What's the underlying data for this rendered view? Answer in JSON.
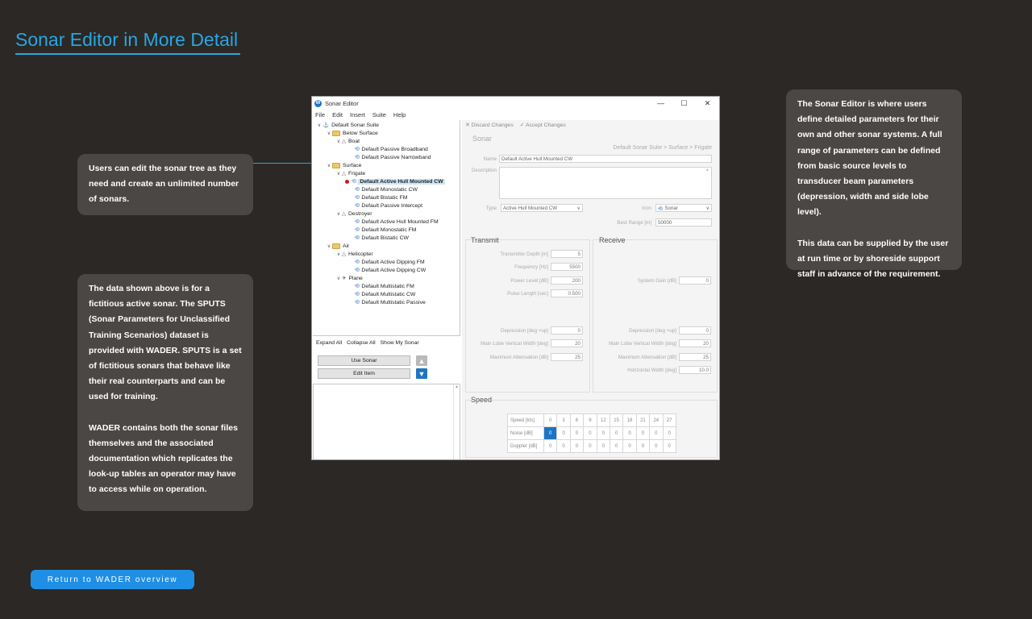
{
  "page": {
    "title": "Sonar Editor in More Detail",
    "return_label": "Return to WADER overview"
  },
  "callouts": {
    "tree": "Users can edit the sonar tree as they need and create an unlimited number of sonars.",
    "data_p1": "The data shown above is for a fictitious active sonar. The SPUTS (Sonar Parameters for Unclassified Training Scenarios) dataset is provided with WADER. SPUTS is a set of fictitious sonars that behave like their real counterparts and can be used for training.",
    "data_p2": "WADER contains both the sonar files themselves and the associated documentation which replicates the look-up tables an operator may have to access while on operation.",
    "editor_p1": "The Sonar Editor is where users define detailed parameters for their own and other sonar systems. A full range of parameters can be defined from basic source levels to transducer beam parameters (depression, width and side lobe level).",
    "editor_p2": "This data can be supplied by the user at run time or by shoreside support staff in advance of the requirement."
  },
  "window": {
    "title": "Sonar Editor",
    "minimize": "—",
    "maximize": "☐",
    "close": "✕",
    "menu": [
      "File",
      "Edit",
      "Insert",
      "Suite",
      "Help"
    ]
  },
  "tree": [
    "Default Sonar Suite",
    "Below Surface",
    "Boat",
    "Default Passive Broadband",
    "Default Passive Narrowband",
    "Surface",
    "Frigate",
    "Default Active Hull Mounted CW",
    "Default Monostatic CW",
    "Default Bistatic FM",
    "Default Passive Intercept",
    "Destroyer",
    "Default Active Hull Mounted FM",
    "Default Monostatic FM",
    "Default Bistatic CW",
    "Air",
    "Helicopter",
    "Default Active Dipping FM",
    "Default Active Dipping CW",
    "Plane",
    "Default Multistatic FM",
    "Default Multistatic CW",
    "Default Multistatic Passive"
  ],
  "tree_actions": {
    "expand_all": "Expand All",
    "collapse_all": "Collapse All",
    "show_my_sonar": "Show My Sonar",
    "use_sonar": "Use Sonar",
    "edit_item": "Edit Item"
  },
  "editor": {
    "discard": "Discard Changes",
    "accept": "Accept Changes",
    "sonar_heading": "Sonar",
    "breadcrumb": "Default Sonar Suite > Surface > Frigate",
    "name_label": "Name",
    "name_value": "Default Active Hull Mounted CW",
    "description_label": "Description",
    "type_label": "Type",
    "type_value": "Active Hull Mounted CW",
    "icon_label": "Icon",
    "icon_value": "Sonar",
    "best_range_label": "Best Range [m]",
    "best_range_value": "50000",
    "transmit_heading": "Transmit",
    "receive_heading": "Receive",
    "transmitter_depth_label": "Transmitter Depth [m]",
    "transmitter_depth": "5",
    "frequency_label": "Frequency [Hz]",
    "frequency": "5500",
    "power_level_label": "Power Level [dB]",
    "power_level": "200",
    "pulse_length_label": "Pulse Length [sec]",
    "pulse_length": "0.500",
    "system_gain_label": "System Gain [dB]",
    "system_gain": "0",
    "tx_depression_label": "Depression [deg +up]",
    "tx_depression": "0",
    "tx_vwidth_label": "Main Lobe Vertical Width [deg]",
    "tx_vwidth": "20",
    "tx_atten_label": "Maximum Attenuation [dB]",
    "tx_atten": "25",
    "rx_depression_label": "Depression [deg +up]",
    "rx_depression": "0",
    "rx_vwidth_label": "Main Lobe Vertical Width [deg]",
    "rx_vwidth": "20",
    "rx_atten_label": "Maximum Attenuation [dB]",
    "rx_atten": "25",
    "rx_hwidth_label": "Horizontal Width [deg]",
    "rx_hwidth": "10.0",
    "speed_heading": "Speed"
  },
  "speed_table": {
    "rows": [
      [
        "Speed [kts]",
        "0",
        "3",
        "6",
        "9",
        "12",
        "15",
        "18",
        "21",
        "24",
        "27"
      ],
      [
        "Noise [dB]",
        "0",
        "0",
        "0",
        "0",
        "0",
        "0",
        "0",
        "0",
        "0",
        "0"
      ],
      [
        "Doppler [dB]",
        "0",
        "0",
        "0",
        "0",
        "0",
        "0",
        "0",
        "0",
        "0",
        "0"
      ]
    ]
  },
  "colors": {
    "background": "#2b2826",
    "accent": "#2aa6e0",
    "callout_bg": "#4a4745",
    "button": "#1f8fe6",
    "selection": "#1e74c4"
  }
}
